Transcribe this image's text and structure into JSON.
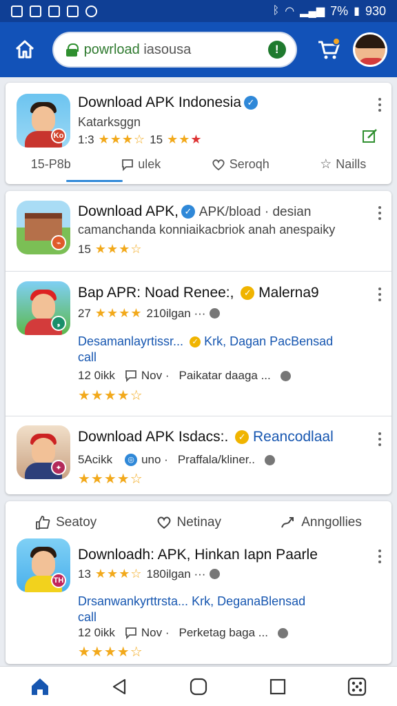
{
  "status_bar": {
    "battery_text": "7%",
    "time": "930"
  },
  "appbar": {
    "search_value_prefix": "powrload",
    "search_value_rest": "iasousa",
    "alert_symbol": "!"
  },
  "featured": {
    "title": "Download APK Indonesia",
    "subtitle": "Katarksggn",
    "rating_left": "1:3",
    "rating_right": "15",
    "icon_badge": "Ko",
    "tabs": [
      {
        "label": "15-P8b",
        "icon": "none"
      },
      {
        "label": "ulek",
        "icon": "chat-square-icon"
      },
      {
        "label": "Seroqh",
        "icon": "heart-icon"
      },
      {
        "label": "Naills",
        "icon": "star-outline-icon"
      }
    ]
  },
  "group1": {
    "item1": {
      "title_main": "Download APK,",
      "title_extra": "APK/bload · desian",
      "description": "camanchanda konniaikacbriok anah anespaiky",
      "rating": "15"
    },
    "item2": {
      "title_main": "Bap APR: Noad Renee:,",
      "title_extra": "Malerna9",
      "rating": "27",
      "downloads": "210ilgan ···",
      "link_line1": "Desamanlayrtissr...",
      "link_line2": "Krk, Dagan PacBensad",
      "link_line3": "call",
      "size": "12 0ikk",
      "date": "Nov ·",
      "extra": "Paikatar daaga ..."
    },
    "item3": {
      "title_main": "Download APK Isdacs:.",
      "title_extra": "Reancodlaal",
      "size": "5Acikk",
      "date": "uno ·",
      "extra": "Praffala/kliner.."
    }
  },
  "group2": {
    "actions": [
      {
        "label": "Seatoy",
        "icon": "thumbs-up-icon"
      },
      {
        "label": "Netinay",
        "icon": "heart-icon"
      },
      {
        "label": "Anngollies",
        "icon": "trend-icon"
      }
    ],
    "item": {
      "title": "Downloadh: APK, Hinkan Iapn Paarle",
      "rating": "13",
      "downloads": "180ilgan ···",
      "icon_badge": "TH",
      "link_line1": "Drsanwankyrttrsta...",
      "link_line2": "Krk, DeganaBlensad",
      "link_line3": "call",
      "size": "12 0ikk",
      "date": "Nov ·",
      "extra": "Perketag baga ..."
    }
  },
  "colors": {
    "brand": "#1252b8",
    "status": "#0f3f95",
    "star": "#f2a91b",
    "link": "#1656b0"
  },
  "icons": [
    "home-icon",
    "lock-icon",
    "cart-icon",
    "back-icon",
    "recents-icon",
    "apps-icon"
  ]
}
